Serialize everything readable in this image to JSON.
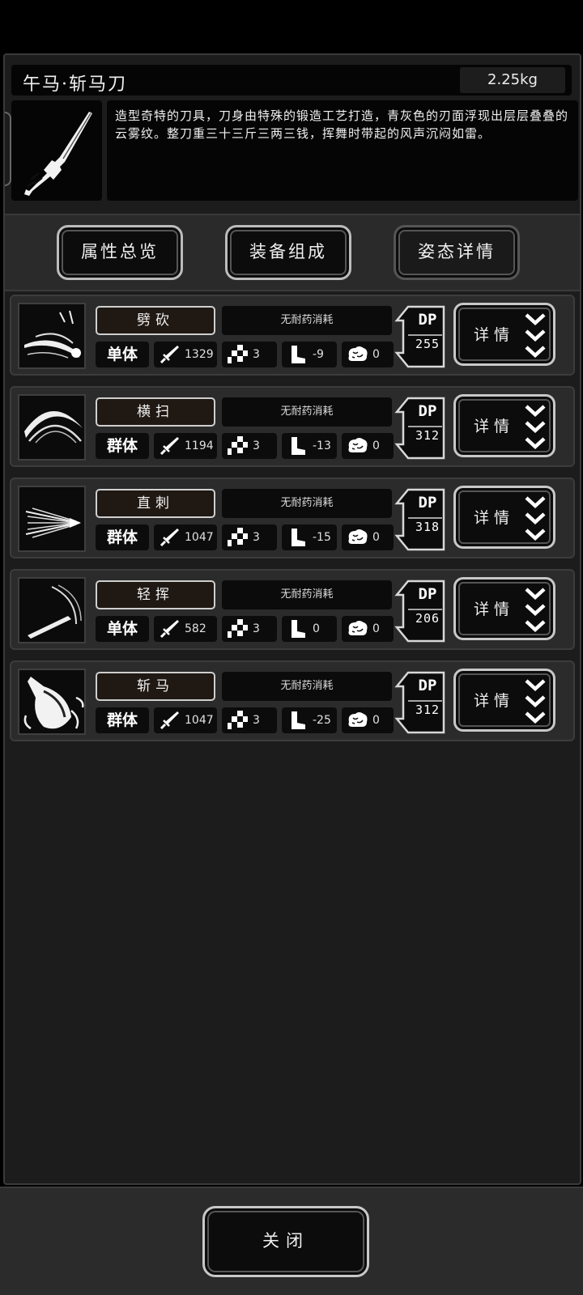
{
  "weapon": {
    "name": "午马·斩马刀",
    "weight": "2.25kg",
    "description": "造型奇特的刀具，刀身由特殊的锻造工艺打造，青灰色的刃面浮现出层层叠叠的云雾纹。整刀重三十三斤三两三钱，挥舞时带起的风声沉闷如雷。",
    "icon": "sword-icon"
  },
  "tabs": [
    {
      "label": "属性总览",
      "active": false
    },
    {
      "label": "装备组成",
      "active": false
    },
    {
      "label": "姿态详情",
      "active": true
    }
  ],
  "skills": [
    {
      "name": "劈砍",
      "cost": "无耐药消耗",
      "target": "单体",
      "attack": "1329",
      "range": "3",
      "move": "-9",
      "mind": "0",
      "dp_label": "DP",
      "dp": "255",
      "detail": "详情",
      "icon": "slash-down-icon"
    },
    {
      "name": "横扫",
      "cost": "无耐药消耗",
      "target": "群体",
      "attack": "1194",
      "range": "3",
      "move": "-13",
      "mind": "0",
      "dp_label": "DP",
      "dp": "312",
      "detail": "详情",
      "icon": "sweep-icon"
    },
    {
      "name": "直刺",
      "cost": "无耐药消耗",
      "target": "群体",
      "attack": "1047",
      "range": "3",
      "move": "-15",
      "mind": "0",
      "dp_label": "DP",
      "dp": "318",
      "detail": "详情",
      "icon": "thrust-icon"
    },
    {
      "name": "轻挥",
      "cost": "无耐药消耗",
      "target": "单体",
      "attack": "582",
      "range": "3",
      "move": "0",
      "mind": "0",
      "dp_label": "DP",
      "dp": "206",
      "detail": "详情",
      "icon": "light-swing-icon"
    },
    {
      "name": "斩马",
      "cost": "无耐药消耗",
      "target": "群体",
      "attack": "1047",
      "range": "3",
      "move": "-25",
      "mind": "0",
      "dp_label": "DP",
      "dp": "312",
      "detail": "详情",
      "icon": "horse-slash-icon"
    }
  ],
  "footer": {
    "close_label": "关闭"
  }
}
